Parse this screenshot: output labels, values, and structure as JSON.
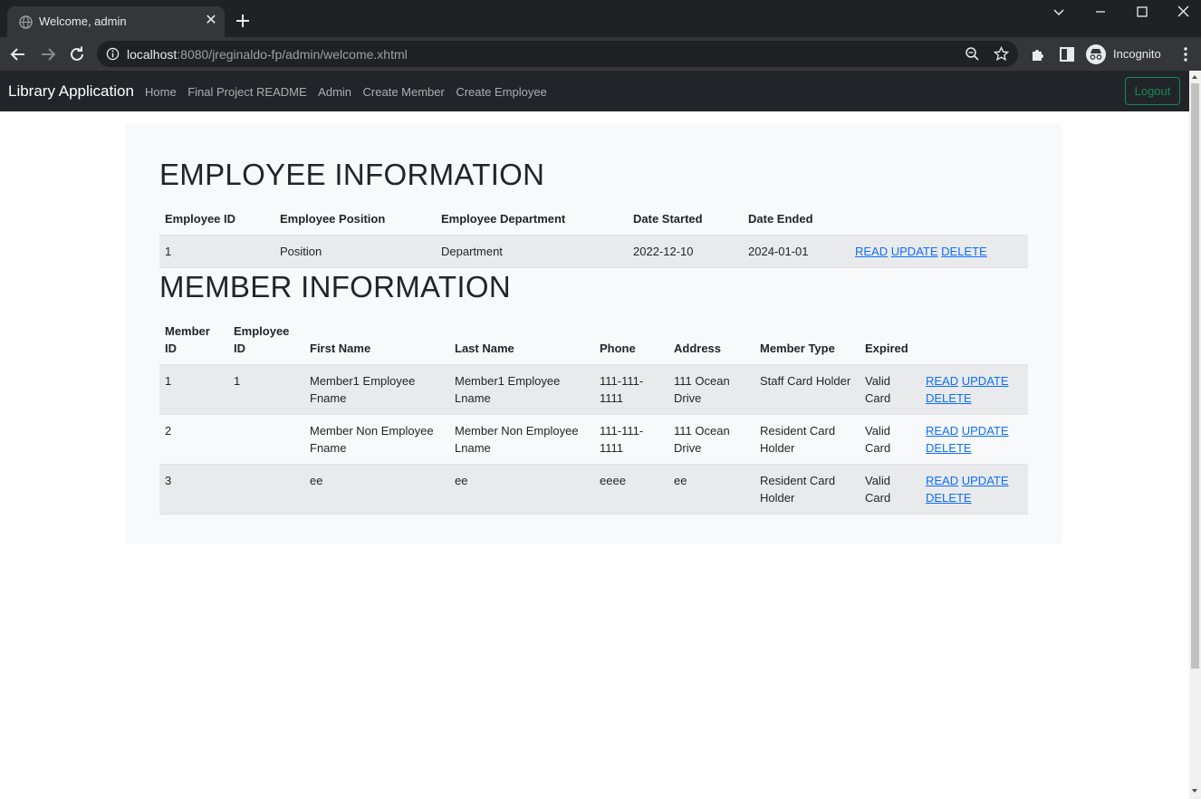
{
  "browser": {
    "tab_title": "Welcome, admin",
    "url_host": "localhost",
    "url_rest": ":8080/jreginaldo-fp/admin/welcome.xhtml",
    "profile_label": "Incognito"
  },
  "navbar": {
    "brand": "Library Application",
    "links": [
      "Home",
      "Final Project README",
      "Admin",
      "Create Member",
      "Create Employee"
    ],
    "logout_label": "Logout"
  },
  "employee_section": {
    "heading": "EMPLOYEE INFORMATION",
    "columns": [
      "Employee ID",
      "Employee Position",
      "Employee Department",
      "Date Started",
      "Date Ended",
      ""
    ],
    "rows": [
      {
        "id": "1",
        "position": "Position",
        "department": "Department",
        "started": "2022-12-10",
        "ended": "2024-01-01",
        "read": "READ",
        "update": "UPDATE",
        "delete": "DELETE"
      }
    ]
  },
  "member_section": {
    "heading": "MEMBER INFORMATION",
    "columns": [
      "Member ID",
      "Employee ID",
      "First Name",
      "Last Name",
      "Phone",
      "Address",
      "Member Type",
      "Expired",
      ""
    ],
    "rows": [
      {
        "member_id": "1",
        "employee_id": "1",
        "first": "Member1 Employee Fname",
        "last": "Member1 Employee Lname",
        "phone": "111-111-1111",
        "address": "111 Ocean Drive",
        "type": "Staff Card Holder",
        "expired": "Valid Card",
        "read": "READ",
        "update": "UPDATE",
        "delete": "DELETE"
      },
      {
        "member_id": "2",
        "employee_id": "",
        "first": "Member Non Employee Fname",
        "last": "Member Non Employee Lname",
        "phone": "111-111-1111",
        "address": "111 Ocean Drive",
        "type": "Resident Card Holder",
        "expired": "Valid Card",
        "read": "READ",
        "update": "UPDATE",
        "delete": "DELETE"
      },
      {
        "member_id": "3",
        "employee_id": "",
        "first": "ee",
        "last": "ee",
        "phone": "eeee",
        "address": "ee",
        "type": "Resident Card Holder",
        "expired": "Valid Card",
        "read": "READ",
        "update": "UPDATE",
        "delete": "DELETE"
      }
    ]
  },
  "colors": {
    "navbar_bg": "#212529",
    "link": "#0d6efd",
    "logout": "#198754",
    "content_bg": "#f8f9fa"
  }
}
